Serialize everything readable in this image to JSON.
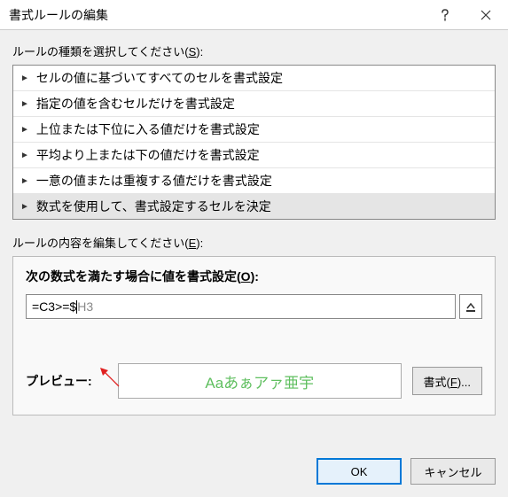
{
  "window": {
    "title": "書式ルールの編集"
  },
  "labels": {
    "select_rule_type": "ルールの種類を選択してください(",
    "select_rule_type_accel": "S",
    "select_rule_type_end": "):",
    "edit_rule_desc": "ルールの内容を編集してください(",
    "edit_rule_desc_accel": "E",
    "edit_rule_desc_end": "):",
    "format_values_where": "次の数式を満たす場合に値を書式設定(",
    "format_values_where_accel": "O",
    "format_values_where_end": "):",
    "preview": "プレビュー:",
    "format_button": "書式(",
    "format_button_accel": "F",
    "format_button_end": ")..."
  },
  "rule_types": [
    "セルの値に基づいてすべてのセルを書式設定",
    "指定の値を含むセルだけを書式設定",
    "上位または下位に入る値だけを書式設定",
    "平均より上または下の値だけを書式設定",
    "一意の値または重複する値だけを書式設定",
    "数式を使用して、書式設定するセルを決定"
  ],
  "formula": {
    "before_caret": "=C3>=$",
    "after_caret": "H3"
  },
  "preview_sample": "Aaあぁアァ亜宇",
  "buttons": {
    "ok": "OK",
    "cancel": "キャンセル"
  }
}
